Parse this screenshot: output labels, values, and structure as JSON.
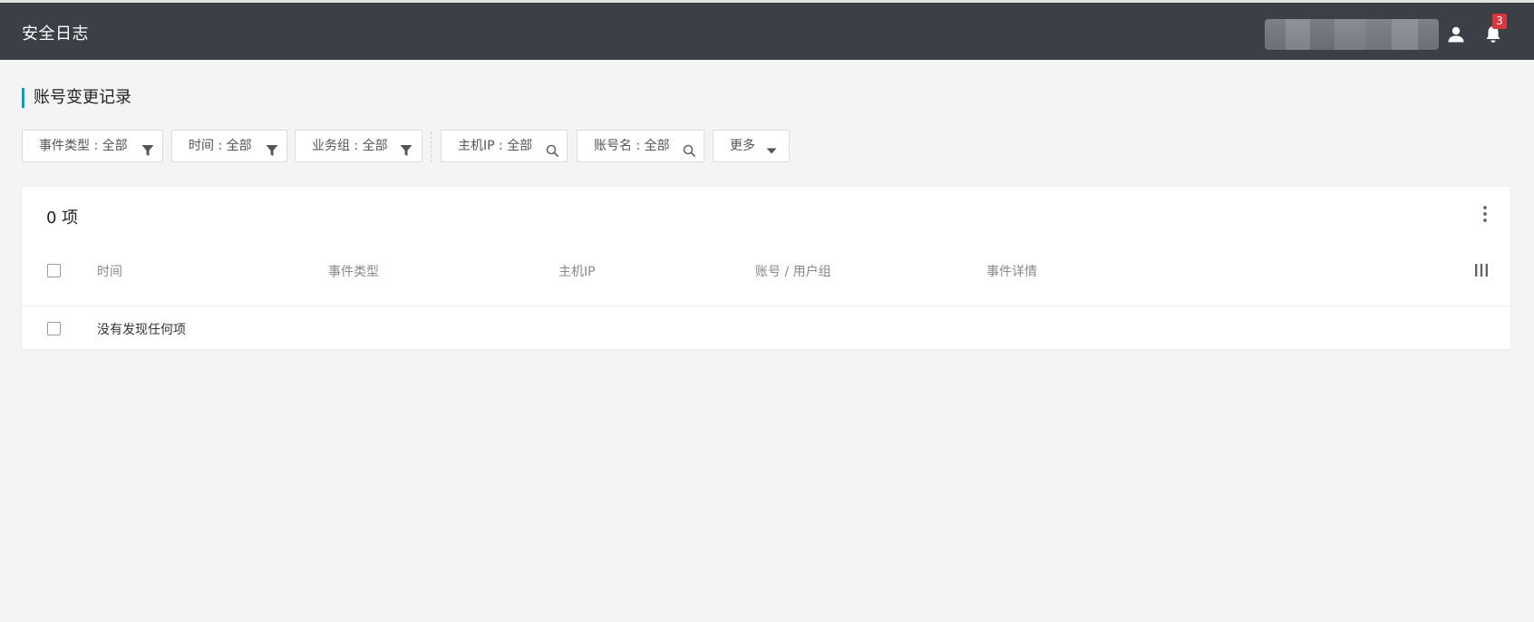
{
  "header": {
    "app_title": "安全日志",
    "notification_count": "3",
    "icons": [
      "user-icon",
      "bell-icon"
    ]
  },
  "section": {
    "title": "账号变更记录"
  },
  "filters": [
    {
      "label": "事件类型 : 全部",
      "icon": "filter-icon"
    },
    {
      "label": "时间 : 全部",
      "icon": "filter-icon"
    },
    {
      "label": "业务组 : 全部",
      "icon": "filter-icon"
    },
    {
      "label": "主机IP : 全部",
      "icon": "search-icon"
    },
    {
      "label": "账号名 : 全部",
      "icon": "search-icon"
    },
    {
      "label": "更多",
      "icon": "caret-down-icon"
    }
  ],
  "table": {
    "count_text": "0 项",
    "columns": [
      "时间",
      "事件类型",
      "主机IP",
      "账号 / 用户组",
      "事件详情"
    ],
    "empty_message": "没有发现任何项"
  },
  "colors": {
    "header_bg": "#3b3f46",
    "accent": "#00a3c4",
    "badge": "#d9363e",
    "page_bg": "#f4f4f4"
  }
}
